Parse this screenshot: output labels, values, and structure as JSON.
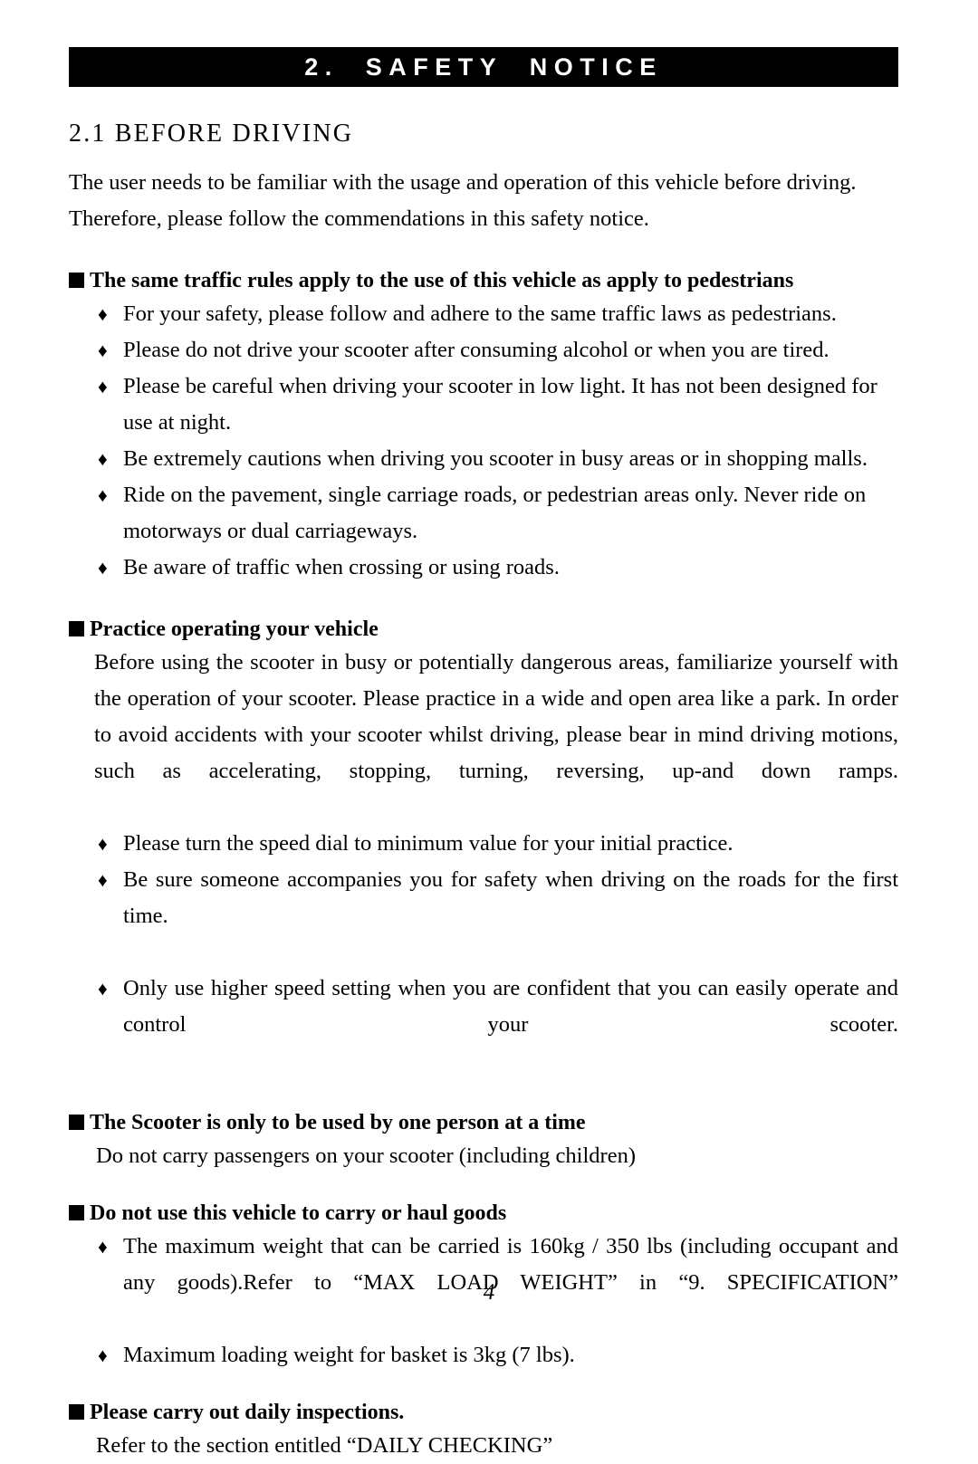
{
  "banner": {
    "title": "2.  SAFETY  NOTICE"
  },
  "section": {
    "heading": "2.1 BEFORE DRIVING",
    "intro": "The user needs to be familiar with the usage and operation of this vehicle before driving. Therefore, please follow the commendations in this safety notice."
  },
  "blocks": [
    {
      "heading": "The same traffic rules apply to the use of this vehicle as apply to pedestrians",
      "bullets": [
        "For your safety, please follow and adhere to the same traffic laws as pedestrians.",
        "Please do not drive your scooter after consuming alcohol or when you are tired.",
        "Please be careful when driving your scooter in low light. It has not been designed for use at night.",
        "Be extremely cautions when driving you scooter in busy areas or in shopping malls.",
        "Ride on the pavement, single carriage roads, or pedestrian areas only. Never ride on motorways or dual carriageways.",
        "Be aware of traffic when crossing or using roads."
      ]
    },
    {
      "heading": "Practice operating your vehicle",
      "paragraph": "Before using the scooter in busy or potentially dangerous areas, familiarize yourself with the operation of your scooter. Please practice in a wide and open area like a park. In order to avoid accidents with your scooter whilst driving, please bear in mind driving motions, such as accelerating, stopping, turning, reversing, up-and down ramps.",
      "bullets": [
        "Please turn the speed dial to minimum value for your initial practice.",
        "Be sure someone accompanies you for safety when driving on the roads for the first time.",
        "Only use higher speed setting when you are confident that you can easily operate and control your scooter."
      ]
    },
    {
      "heading": "The Scooter is only to be used by one person at a time",
      "note": "Do not carry passengers on your scooter (including children)"
    },
    {
      "heading": "Do not use this vehicle to carry or haul goods",
      "bullets": [
        "The maximum weight that can be carried is 160kg / 350 lbs (including occupant and any goods).Refer to “MAX LOAD WEIGHT” in “9. SPECIFICATION”",
        "Maximum loading weight for basket is 3kg (7 lbs)."
      ]
    },
    {
      "heading": "Please carry out daily inspections.",
      "note": "Refer to the section entitled “DAILY CHECKING”"
    }
  ],
  "bullet_glyph": "♦",
  "footer": {
    "page_number": "4"
  }
}
